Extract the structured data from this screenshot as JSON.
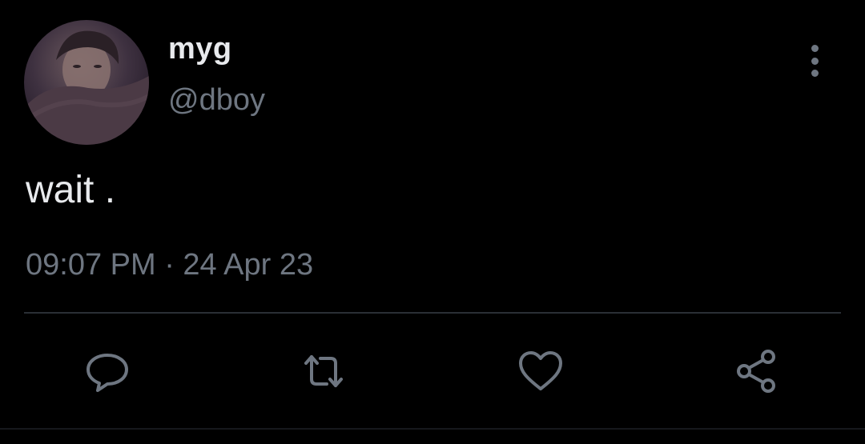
{
  "user": {
    "display_name": "myg",
    "handle": "@dboy"
  },
  "tweet": {
    "text": "wait .",
    "timestamp": "09:07 PM · 24 Apr 23"
  },
  "actions": [
    {
      "name": "reply",
      "icon": "reply-icon"
    },
    {
      "name": "retweet",
      "icon": "retweet-icon"
    },
    {
      "name": "like",
      "icon": "heart-icon"
    },
    {
      "name": "share",
      "icon": "share-icon"
    }
  ],
  "colors": {
    "background": "#000000",
    "primary_text": "#e8eaed",
    "secondary_text": "#6e7681",
    "divider": "#2a2f35"
  }
}
